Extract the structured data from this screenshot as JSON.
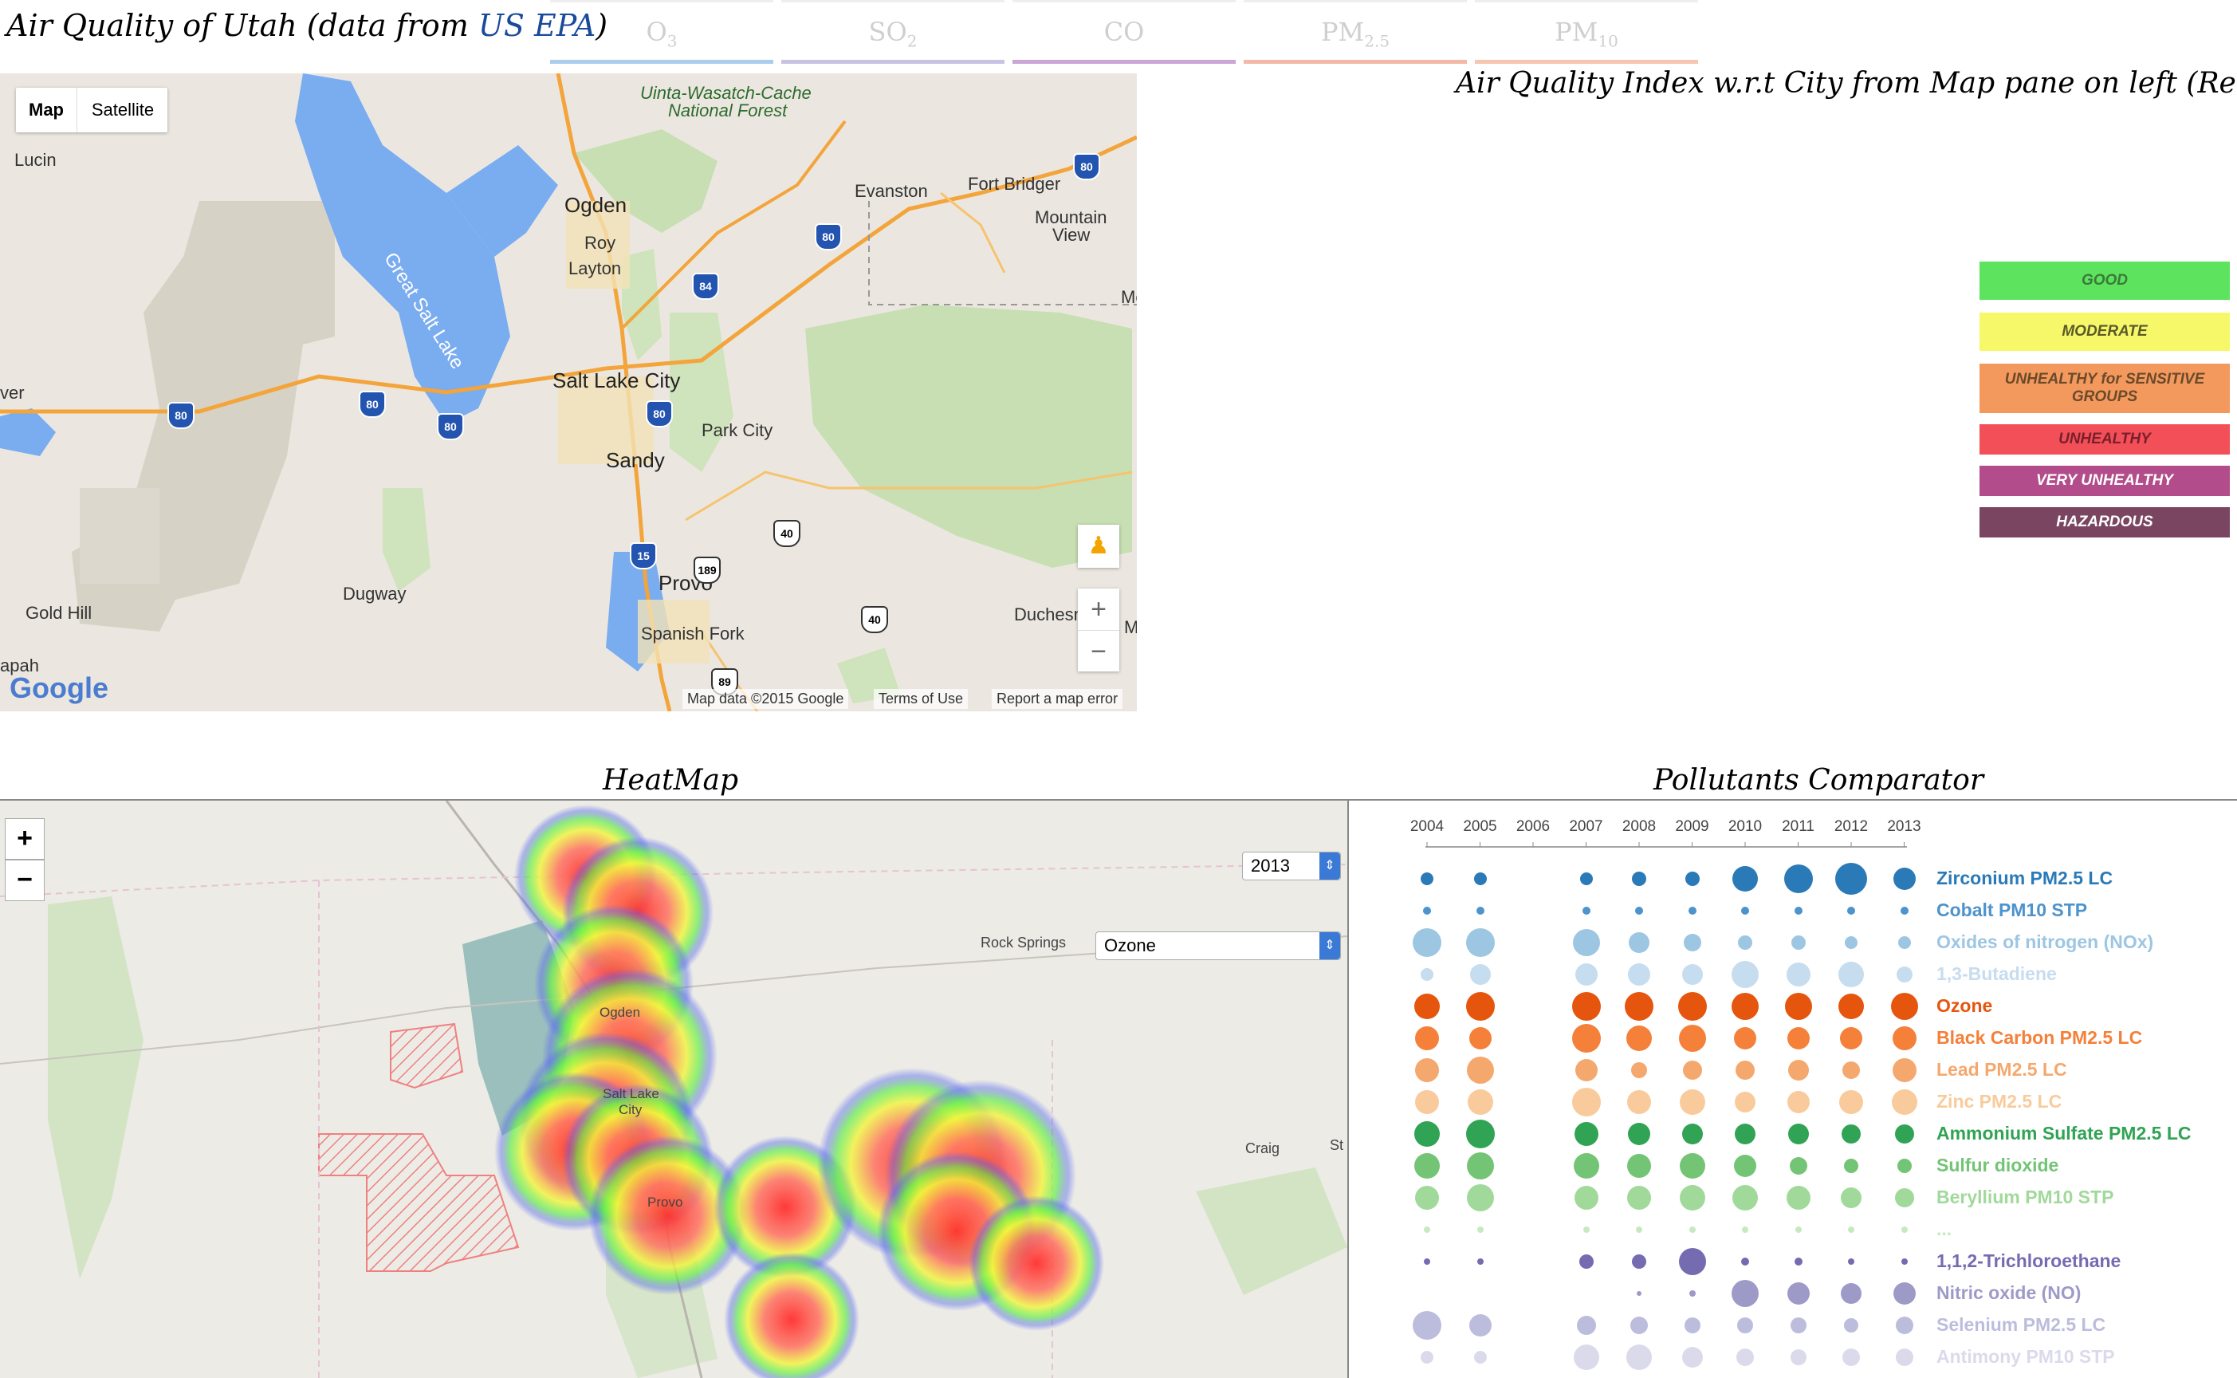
{
  "header": {
    "title_prefix": "Air Quality of Utah (data from ",
    "title_link": "US EPA",
    "title_suffix": ")",
    "subtitle": "Air Quality Index w.r.t City from Map pane on left (Real data)"
  },
  "pollutant_tabs": [
    {
      "base": "O",
      "sub": "3",
      "color": "#a9cdeb"
    },
    {
      "base": "SO",
      "sub": "2",
      "color": "#c9c2e3"
    },
    {
      "base": "CO",
      "sub": "",
      "color": "#c9a6d6"
    },
    {
      "base": "PM",
      "sub": "2.5",
      "color": "#f4b9a6"
    },
    {
      "base": "PM",
      "sub": "10",
      "color": "#f6c6b0"
    }
  ],
  "map": {
    "type_buttons": [
      "Map",
      "Satellite"
    ],
    "labels": {
      "uinta": "Uinta-Wasatch-Cache",
      "uinta2": "National Forest",
      "lucin": "Lucin",
      "ogden": "Ogden",
      "roy": "Roy",
      "layton": "Layton",
      "great_salt_lake": "Great Salt Lake",
      "evanston": "Evanston",
      "fort_bridger": "Fort Bridger",
      "mountain_view": "Mountain",
      "mountain_view2": "View",
      "salt_lake_city": "Salt Lake City",
      "park_city": "Park City",
      "sandy": "Sandy",
      "provo": "Provo",
      "spanish_fork": "Spanish Fork",
      "dugway": "Dugway",
      "gold_hill": "Gold Hill",
      "duchesne": "Duchesn",
      "wendover": "ver",
      "ibapah": "apah",
      "mc": "Mo",
      "m2": "M"
    },
    "shields": [
      "80",
      "80",
      "80",
      "80",
      "80",
      "84",
      "15",
      "189",
      "40",
      "40",
      "89",
      "80"
    ],
    "attribution": {
      "data": "Map data ©2015 Google",
      "terms": "Terms of Use",
      "report": "Report a map error"
    },
    "logo": "Google",
    "zoom_in": "+",
    "zoom_out": "−"
  },
  "aqi_legend": [
    {
      "label": "GOOD",
      "color": "#5ee35e",
      "text_color": "#3a7a3a"
    },
    {
      "label": "MODERATE",
      "color": "#f7f76a",
      "text_color": "#5a5a2a"
    },
    {
      "label": "UNHEALTHY for SENSITIVE GROUPS",
      "color": "#f4995e",
      "text_color": "#6a4a2a"
    },
    {
      "label": "UNHEALTHY",
      "color": "#f24f58",
      "text_color": "#7a1f2a"
    },
    {
      "label": "VERY UNHEALTHY",
      "color": "#b24c8a",
      "text_color": "#ffffff"
    },
    {
      "label": "HAZARDOUS",
      "color": "#7a4560",
      "text_color": "#ffffff"
    }
  ],
  "heatmap": {
    "title": "HeatMap",
    "year_value": "2013",
    "pollutant_value": "Ozone",
    "zoom_in": "+",
    "zoom_out": "−",
    "labels": {
      "ogden": "Ogden",
      "salt_lake": "Salt Lake",
      "city": "City",
      "provo": "Provo",
      "rock_springs": "Rock Springs",
      "craig": "Craig",
      "st": "St"
    }
  },
  "comparator": {
    "title": "Pollutants Comparator",
    "years": [
      "2004",
      "2005",
      "2006",
      "2007",
      "2008",
      "2009",
      "2010",
      "2011",
      "2012",
      "2013"
    ],
    "pollutants": [
      {
        "name": "Zirconium PM2.5 LC",
        "color": "#2a7ab8",
        "sizes": [
          8,
          8,
          0,
          8,
          9,
          9,
          16,
          18,
          20,
          14
        ]
      },
      {
        "name": "Cobalt PM10 STP",
        "color": "#4d93cc",
        "sizes": [
          5,
          5,
          0,
          5,
          5,
          5,
          5,
          5,
          5,
          5
        ]
      },
      {
        "name": "Oxides of nitrogen (NOx)",
        "color": "#9dc6e3",
        "sizes": [
          18,
          18,
          0,
          17,
          13,
          11,
          9,
          9,
          8,
          8
        ]
      },
      {
        "name": "1,3-Butadiene",
        "color": "#c6dcef",
        "sizes": [
          8,
          13,
          0,
          14,
          14,
          13,
          17,
          15,
          16,
          10
        ]
      },
      {
        "name": "Ozone",
        "color": "#e6550d",
        "sizes": [
          16,
          18,
          0,
          18,
          18,
          18,
          17,
          17,
          16,
          17
        ]
      },
      {
        "name": "Black Carbon PM2.5 LC",
        "color": "#f4803a",
        "sizes": [
          15,
          14,
          0,
          18,
          16,
          17,
          14,
          14,
          14,
          15
        ]
      },
      {
        "name": "Lead PM2.5 LC",
        "color": "#f5a86e",
        "sizes": [
          15,
          17,
          0,
          14,
          10,
          12,
          12,
          13,
          11,
          15
        ]
      },
      {
        "name": "Zinc PM2.5 LC",
        "color": "#f9cb9c",
        "sizes": [
          15,
          16,
          0,
          18,
          15,
          16,
          13,
          14,
          15,
          16
        ]
      },
      {
        "name": "Ammonium Sulfate PM2.5 LC",
        "color": "#31a354",
        "sizes": [
          16,
          18,
          0,
          15,
          14,
          13,
          13,
          13,
          12,
          12
        ]
      },
      {
        "name": "Sulfur dioxide",
        "color": "#74c476",
        "sizes": [
          16,
          17,
          0,
          16,
          15,
          16,
          14,
          11,
          9,
          9
        ]
      },
      {
        "name": "Beryllium PM10 STP",
        "color": "#a1d99b",
        "sizes": [
          15,
          17,
          0,
          15,
          15,
          16,
          16,
          15,
          13,
          12
        ]
      },
      {
        "name": "...",
        "color": "#c7e9c0",
        "sizes": [
          4,
          4,
          0,
          4,
          4,
          4,
          4,
          4,
          4,
          4
        ]
      },
      {
        "name": "1,1,2-Trichloroethane",
        "color": "#756bb1",
        "sizes": [
          4,
          4,
          0,
          9,
          9,
          17,
          5,
          5,
          4,
          4
        ]
      },
      {
        "name": "Nitric oxide (NO)",
        "color": "#9e9ac8",
        "sizes": [
          0,
          0,
          0,
          0,
          3,
          4,
          17,
          14,
          13,
          14
        ]
      },
      {
        "name": "Selenium PM2.5 LC",
        "color": "#bcbddc",
        "sizes": [
          18,
          14,
          0,
          12,
          11,
          10,
          10,
          10,
          9,
          11
        ]
      },
      {
        "name": "Antimony PM10 STP",
        "color": "#dadaeb",
        "sizes": [
          8,
          8,
          0,
          16,
          16,
          13,
          11,
          10,
          11,
          11
        ]
      }
    ]
  }
}
